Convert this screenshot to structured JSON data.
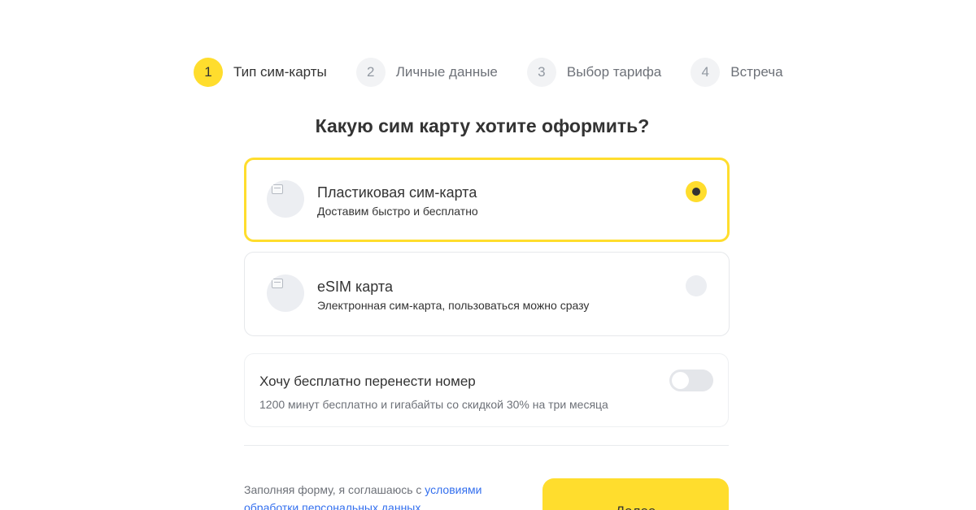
{
  "stepper": {
    "steps": [
      {
        "number": "1",
        "label": "Тип сим-карты"
      },
      {
        "number": "2",
        "label": "Личные данные"
      },
      {
        "number": "3",
        "label": "Выбор тарифа"
      },
      {
        "number": "4",
        "label": "Встреча"
      }
    ],
    "active_step": 1
  },
  "heading": "Какую сим карту хотите оформить?",
  "options": [
    {
      "title": "Пластиковая сим-карта",
      "subtitle": "Доставим быстро и бесплатно",
      "icon": "image-placeholder-icon",
      "selected": true
    },
    {
      "title": "eSIM карта",
      "subtitle": "Электронная сим-карта, пользоваться можно сразу",
      "icon": "image-placeholder-icon",
      "selected": false
    }
  ],
  "transfer": {
    "title": "Хочу бесплатно перенести номер",
    "subtitle": "1200 минут бесплатно и гигабайты со скидкой 30% на три месяца",
    "enabled": false
  },
  "footer": {
    "consent_prefix": "Заполняя форму, я соглашаюсь с ",
    "consent_link": "условиями обработки персональных данных",
    "next_label": "Далее"
  },
  "colors": {
    "accent": "#ffdd2d",
    "text": "#333333",
    "muted": "#6d7178",
    "link": "#336fee"
  }
}
